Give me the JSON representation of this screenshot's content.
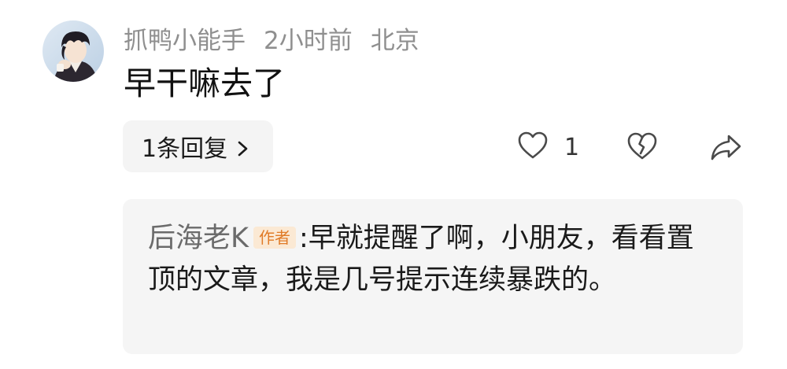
{
  "comment": {
    "author": "抓鸭小能手",
    "time": "2小时前",
    "location": "北京",
    "text": "早干嘛去了",
    "avatar_icon": "anime-boy-avatar"
  },
  "replies_button": {
    "label": "1条回复"
  },
  "actions": {
    "like_icon": "heart-outline-icon",
    "like_count": "1",
    "dislike_icon": "broken-heart-icon",
    "share_icon": "share-arrow-icon"
  },
  "reply": {
    "author": "后海老K",
    "badge": "作者",
    "separator": ":",
    "text": "早就提醒了啊，小朋友，看看置顶的文章，我是几号提示连续暴跌的。"
  },
  "colors": {
    "meta_gray": "#8f8f8f",
    "card_bg": "#f5f5f5",
    "badge_bg": "#fbe9d4",
    "badge_text": "#e07b28"
  }
}
